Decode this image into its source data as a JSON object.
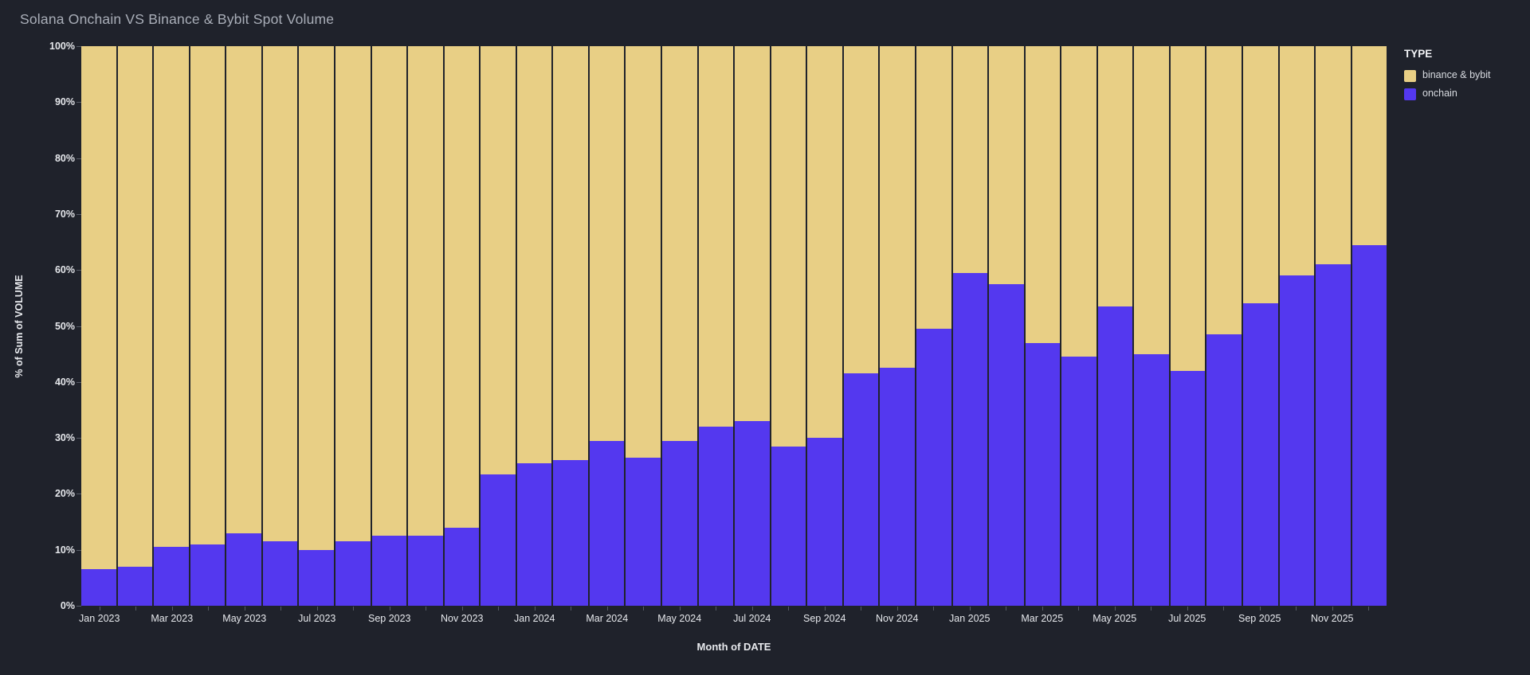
{
  "title": "Solana Onchain VS Binance & Bybit Spot Volume",
  "colors": {
    "background": "#1f222b",
    "binance_bybit": "#e8cf85",
    "onchain": "#5438ef",
    "bar_separator": "#20232b",
    "axis_text": "#e6e8ec",
    "title_text": "#a9aeb8"
  },
  "legend": {
    "title": "TYPE",
    "items": [
      {
        "label": "binance & bybit",
        "color": "#e8cf85",
        "key": "binance_bybit"
      },
      {
        "label": "onchain",
        "color": "#5438ef",
        "key": "onchain"
      }
    ]
  },
  "chart_data": {
    "type": "bar",
    "stacked_percent": true,
    "title": "Solana Onchain VS Binance & Bybit Spot Volume",
    "xlabel": "Month of DATE",
    "ylabel": "% of Sum of VOLUME",
    "ylim": [
      0,
      100
    ],
    "y_tick_labels": [
      "0%",
      "10%",
      "20%",
      "30%",
      "40%",
      "50%",
      "60%",
      "70%",
      "80%",
      "90%",
      "100%"
    ],
    "x_label_every": 2,
    "legend_position": "right",
    "grid": false,
    "categories": [
      "Jan 2023",
      "Feb 2023",
      "Mar 2023",
      "Apr 2023",
      "May 2023",
      "Jun 2023",
      "Jul 2023",
      "Aug 2023",
      "Sep 2023",
      "Oct 2023",
      "Nov 2023",
      "Dec 2023",
      "Jan 2024",
      "Feb 2024",
      "Mar 2024",
      "Apr 2024",
      "May 2024",
      "Jun 2024",
      "Jul 2024",
      "Aug 2024",
      "Sep 2024",
      "Oct 2024",
      "Nov 2024",
      "Dec 2024",
      "Jan 2025",
      "Feb 2025",
      "Mar 2025",
      "Apr 2025",
      "May 2025",
      "Jun 2025",
      "Jul 2025",
      "Aug 2025",
      "Sep 2025",
      "Oct 2025",
      "Nov 2025",
      "Dec 2025"
    ],
    "series": [
      {
        "name": "onchain",
        "color": "#5438ef",
        "values": [
          6.5,
          7,
          10.5,
          11,
          13,
          11.5,
          10,
          11.5,
          12.5,
          12.5,
          14,
          23.5,
          25.5,
          26,
          29.5,
          26.5,
          29.5,
          32,
          33,
          28.5,
          30,
          41.5,
          42.5,
          49.5,
          59.5,
          57.5,
          47,
          44.5,
          53.5,
          45,
          42,
          48.5,
          54,
          59,
          61,
          64.5
        ]
      },
      {
        "name": "binance & bybit",
        "color": "#e8cf85",
        "values": [
          93.5,
          93,
          89.5,
          89,
          87,
          88.5,
          90,
          88.5,
          87.5,
          87.5,
          86,
          76.5,
          74.5,
          74,
          70.5,
          73.5,
          70.5,
          68,
          67,
          71.5,
          70,
          58.5,
          57.5,
          50.5,
          40.5,
          42.5,
          53,
          55.5,
          46.5,
          55,
          58,
          51.5,
          46,
          41,
          39,
          35.5
        ]
      }
    ]
  }
}
